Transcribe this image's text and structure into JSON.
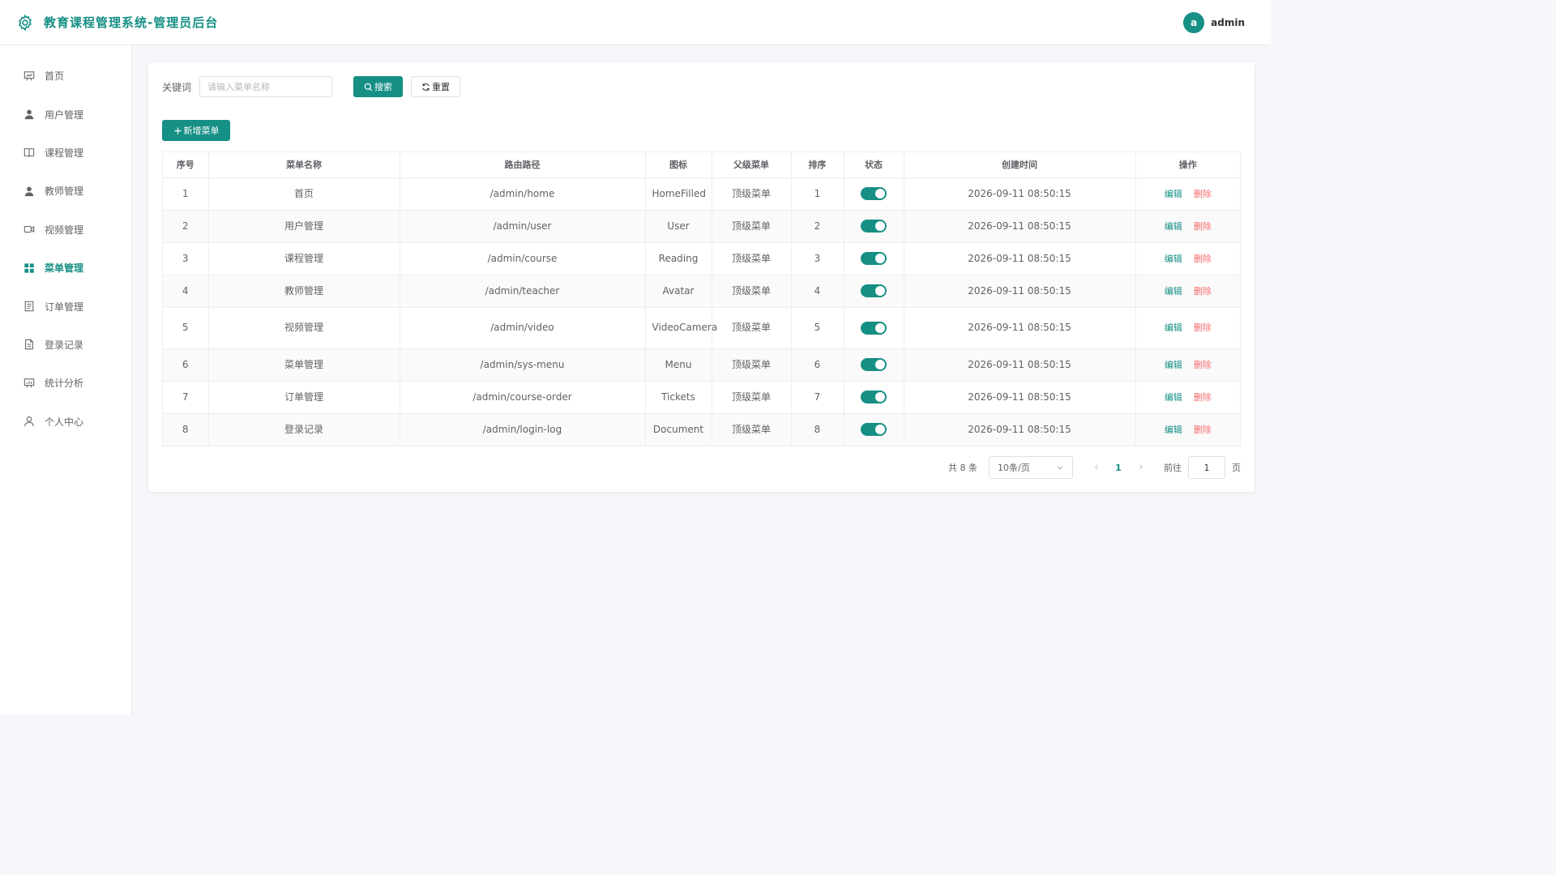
{
  "header": {
    "title": "教育课程管理系统-管理员后台",
    "user": {
      "avatar_letter": "a",
      "name": "admin"
    },
    "accent_color": "#168f85"
  },
  "sidebar": {
    "items": [
      {
        "label": "首页",
        "icon": "dashboard-icon",
        "active": false
      },
      {
        "label": "用户管理",
        "icon": "user-icon",
        "active": false
      },
      {
        "label": "课程管理",
        "icon": "book-icon",
        "active": false
      },
      {
        "label": "教师管理",
        "icon": "avatar-icon",
        "active": false
      },
      {
        "label": "视频管理",
        "icon": "video-camera-icon",
        "active": false
      },
      {
        "label": "菜单管理",
        "icon": "menu-grid-icon",
        "active": true
      },
      {
        "label": "订单管理",
        "icon": "tickets-icon",
        "active": false
      },
      {
        "label": "登录记录",
        "icon": "document-icon",
        "active": false
      },
      {
        "label": "统计分析",
        "icon": "chart-icon",
        "active": false
      },
      {
        "label": "个人中心",
        "icon": "user-outline-icon",
        "active": false
      }
    ]
  },
  "search": {
    "label": "关键词",
    "placeholder": "请输入菜单名称",
    "value": "",
    "search_button": "搜索",
    "reset_button": "重置"
  },
  "toolbar": {
    "add_button": "新增菜单"
  },
  "table": {
    "columns": [
      "序号",
      "菜单名称",
      "路由路径",
      "图标",
      "父级菜单",
      "排序",
      "状态",
      "创建时间",
      "操作"
    ],
    "rows": [
      {
        "index": "1",
        "name": "首页",
        "path": "/admin/home",
        "icon": "HomeFilled",
        "parent": "顶级菜单",
        "sort": "1",
        "enabled": true,
        "created": "2026-09-11 08:50:15"
      },
      {
        "index": "2",
        "name": "用户管理",
        "path": "/admin/user",
        "icon": "User",
        "parent": "顶级菜单",
        "sort": "2",
        "enabled": true,
        "created": "2026-09-11 08:50:15"
      },
      {
        "index": "3",
        "name": "课程管理",
        "path": "/admin/course",
        "icon": "Reading",
        "parent": "顶级菜单",
        "sort": "3",
        "enabled": true,
        "created": "2026-09-11 08:50:15"
      },
      {
        "index": "4",
        "name": "教师管理",
        "path": "/admin/teacher",
        "icon": "Avatar",
        "parent": "顶级菜单",
        "sort": "4",
        "enabled": true,
        "created": "2026-09-11 08:50:15"
      },
      {
        "index": "5",
        "name": "视频管理",
        "path": "/admin/video",
        "icon": "VideoCamera",
        "parent": "顶级菜单",
        "sort": "5",
        "enabled": true,
        "created": "2026-09-11 08:50:15"
      },
      {
        "index": "6",
        "name": "菜单管理",
        "path": "/admin/sys-menu",
        "icon": "Menu",
        "parent": "顶级菜单",
        "sort": "6",
        "enabled": true,
        "created": "2026-09-11 08:50:15"
      },
      {
        "index": "7",
        "name": "订单管理",
        "path": "/admin/course-order",
        "icon": "Tickets",
        "parent": "顶级菜单",
        "sort": "7",
        "enabled": true,
        "created": "2026-09-11 08:50:15"
      },
      {
        "index": "8",
        "name": "登录记录",
        "path": "/admin/login-log",
        "icon": "Document",
        "parent": "顶级菜单",
        "sort": "8",
        "enabled": true,
        "created": "2026-09-11 08:50:15"
      }
    ],
    "edit_label": "编辑",
    "delete_label": "删除"
  },
  "pagination": {
    "total_text": "共 8 条",
    "page_size": "10条/页",
    "current_page": "1",
    "goto_label": "前往",
    "goto_value": "1",
    "page_unit": "页"
  }
}
